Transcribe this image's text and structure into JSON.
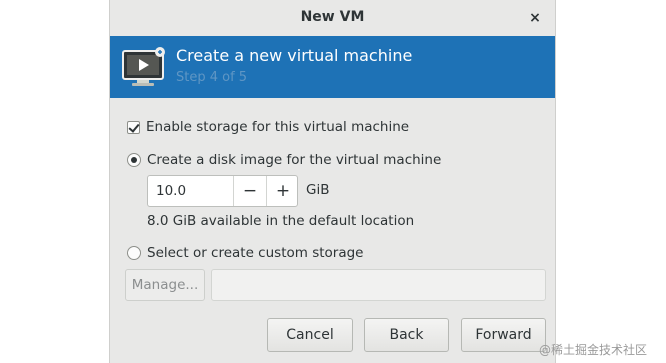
{
  "window": {
    "title": "New VM",
    "close_glyph": "×",
    "close_icon": "close-icon"
  },
  "banner": {
    "icon": "monitor-play-icon",
    "heading": "Create a new virtual machine",
    "step": "Step 4 of 5",
    "background": "#1e72b6"
  },
  "storage": {
    "enable_label": "Enable storage for this virtual machine",
    "enable_checked": true,
    "create_disk_label": "Create a disk image for the virtual machine",
    "create_disk_selected": true,
    "size_value": "10.0",
    "minus_label": "−",
    "plus_label": "+",
    "unit": "GiB",
    "available_text": "8.0 GiB available in the default location",
    "custom_label": "Select or create custom storage",
    "custom_selected": false,
    "manage_label": "Manage...",
    "custom_path_value": ""
  },
  "buttons": {
    "cancel": "Cancel",
    "back": "Back",
    "forward": "Forward"
  },
  "watermark": "@稀土掘金技术社区"
}
